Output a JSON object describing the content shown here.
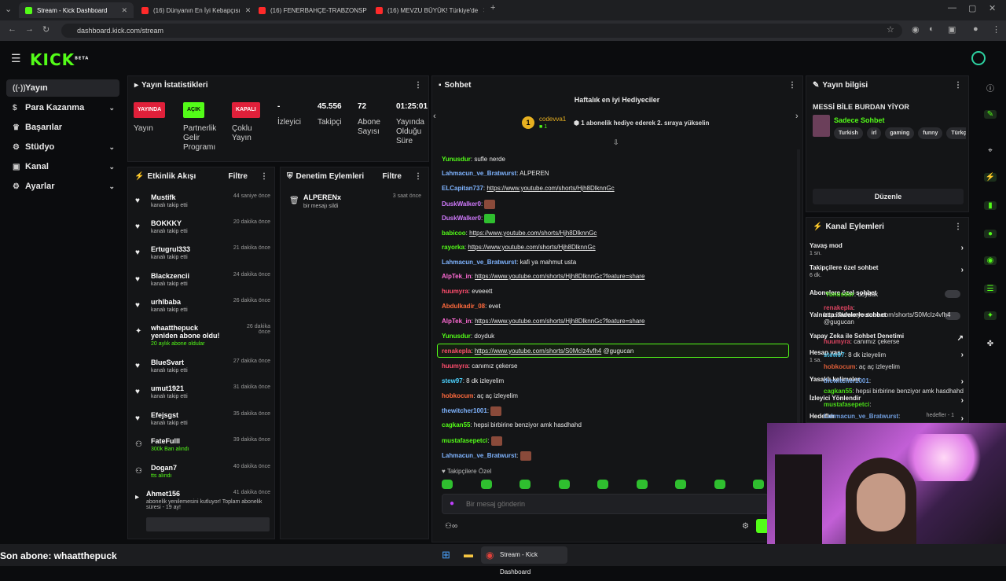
{
  "browser": {
    "tabs": [
      {
        "label": "Stream - Kick Dashboard",
        "active": true
      },
      {
        "label": "(16) Dünyanın En İyi Kebapçısı",
        "active": false
      },
      {
        "label": "(16) FENERBAHÇE-TRABZONSP",
        "active": false
      },
      {
        "label": "(16) MEVZU BÜYÜK! Türkiye'de",
        "active": false
      }
    ],
    "url": "dashboard.kick.com/stream"
  },
  "brand": {
    "logo": "KICK",
    "logo_sup": "BETA"
  },
  "sidebar": {
    "items": [
      {
        "label": "Yayın",
        "icon": "broadcast-icon",
        "has_chevron": false
      },
      {
        "label": "Para Kazanma",
        "icon": "money-icon",
        "has_chevron": true
      },
      {
        "label": "Başarılar",
        "icon": "trophy-icon",
        "has_chevron": false
      },
      {
        "label": "Stüdyo",
        "icon": "gear-icon",
        "has_chevron": true
      },
      {
        "label": "Kanal",
        "icon": "channel-icon",
        "has_chevron": true
      },
      {
        "label": "Ayarlar",
        "icon": "settings-icon",
        "has_chevron": true
      }
    ]
  },
  "stats": {
    "title": "Yayın İstatistikleri",
    "items": [
      {
        "badge": "YAYINDA",
        "label": "Yayın",
        "color": "#e0203a"
      },
      {
        "badge": "AÇIK",
        "label": "Partnerlik Gelir Programı",
        "color": "#53fc18"
      },
      {
        "badge": "KAPALI",
        "label": "Çoklu Yayın",
        "color": "#e0203a"
      },
      {
        "value": "-",
        "label": "İzleyici"
      },
      {
        "value": "45.556",
        "label": "Takipçi"
      },
      {
        "value": "72",
        "label": "Abone Sayısı"
      },
      {
        "value": "01:25:01",
        "label": "Yayında Olduğu Süre"
      }
    ]
  },
  "activity": {
    "title": "Etkinlik Akışı",
    "filter": "Filtre",
    "items": [
      {
        "name": "Mustifk",
        "sub": "kanalı takip etti",
        "time": "44 saniye önce"
      },
      {
        "name": "BOKKKY",
        "sub": "kanalı takip etti",
        "time": "20 dakika önce"
      },
      {
        "name": "Ertugrul333",
        "sub": "kanalı takip etti",
        "time": "21 dakika önce"
      },
      {
        "name": "Blackzencii",
        "sub": "kanalı takip etti",
        "time": "24 dakika önce"
      },
      {
        "name": "urhlbaba",
        "sub": "kanalı takip etti",
        "time": "26 dakika önce"
      },
      {
        "name": "whaatthepuck yeniden abone oldu!",
        "sub": "20 aylık abone oldular",
        "time": "26 dakika önce"
      },
      {
        "name": "BlueSvart",
        "sub": "kanalı takip etti",
        "time": "27 dakika önce"
      },
      {
        "name": "umut1921",
        "sub": "kanalı takip etti",
        "time": "31 dakika önce"
      },
      {
        "name": "Efejsgst",
        "sub": "kanalı takip etti",
        "time": "35 dakika önce"
      },
      {
        "name": "FateFulll",
        "sub": "300k Ban alındı",
        "time": "39 dakika önce"
      },
      {
        "name": "Dogan7",
        "sub": "tts alındı",
        "time": "40 dakika önce"
      },
      {
        "name": "Ahmet156",
        "sub": "abonelik yenilemesini kutluyor! Toplam abonelik süresi - 19 ay!",
        "time": "41 dakika önce"
      }
    ]
  },
  "moderation": {
    "title": "Denetim Eylemleri",
    "filter": "Filtre",
    "items": [
      {
        "name": "ALPERENx",
        "sub": "bir mesajı sildi",
        "time": "3 saat önce"
      }
    ]
  },
  "chat": {
    "title": "Sohbet",
    "gifters_title": "Haftalık en iyi Hediyeciler",
    "top_gifter": "codevva1",
    "top_gifter_count": "1",
    "gift_hint": "1 abonelik hediye ederek 2. sıraya yükselin",
    "messages": [
      {
        "user": "Yunusdur",
        "color": "#53fc18",
        "text": "sufle nerde"
      },
      {
        "user": "Lahmacun_ve_Bratwurst",
        "color": "#7fb4ff",
        "text": "ALPEREN"
      },
      {
        "user": "ELCapitan737",
        "color": "#7fb4ff",
        "link": "https://www.youtube.com/shorts/Hjh8DlknnGc"
      },
      {
        "user": "DuskWalker0",
        "color": "#d27bff",
        "text": ""
      },
      {
        "user": "DuskWalker0",
        "color": "#d27bff",
        "text": ""
      },
      {
        "user": "babicoo",
        "color": "#53fc18",
        "link": "https://www.youtube.com/shorts/Hjh8DlknnGc"
      },
      {
        "user": "rayorka",
        "color": "#53fc18",
        "link": "https://www.youtube.com/shorts/Hjh8DlknnGc"
      },
      {
        "user": "Lahmacun_ve_Bratwurst",
        "color": "#7fb4ff",
        "text": "kafi ya mahmut usta"
      },
      {
        "user": "AlpTek_in",
        "color": "#ff6bd5",
        "link": "https://www.youtube.com/shorts/Hjh8DlknnGc?feature=share"
      },
      {
        "user": "huumyra",
        "color": "#ff4d6d",
        "text": "eveeett"
      },
      {
        "user": "Abdulkadir_08",
        "color": "#ff6a3d",
        "text": "evet"
      },
      {
        "user": "AlpTek_in",
        "color": "#ff6bd5",
        "link": "https://www.youtube.com/shorts/Hjh8DlknnGc?feature=share"
      },
      {
        "user": "Yunusdur",
        "color": "#53fc18",
        "text": "doyduk"
      },
      {
        "user": "renakepla",
        "color": "#ff4d6d",
        "link": "https://www.youtube.com/shorts/S0McIz4vfh4",
        "text": "@gugucan"
      },
      {
        "user": "huumyra",
        "color": "#ff4d6d",
        "text": "canımız çekerse"
      },
      {
        "user": "stew97",
        "color": "#4dd2ff",
        "text": "8 dk izleyelim"
      },
      {
        "user": "hobkocum",
        "color": "#ff6a3d",
        "text": "aç aç izleyelim"
      },
      {
        "user": "thewitcher1001",
        "color": "#7fb4ff",
        "text": ""
      },
      {
        "user": "cagkan55",
        "color": "#53fc18",
        "text": "hepsi birbirine benziyor amk hasdhahd"
      },
      {
        "user": "mustafasepetci",
        "color": "#53fc18",
        "text": ""
      },
      {
        "user": "Lahmacun_ve_Bratwurst",
        "color": "#7fb4ff",
        "text": ""
      }
    ],
    "followers_only": "Takipçilere Özel",
    "input_placeholder": "Bir mesaj gönderin"
  },
  "stream_info": {
    "title": "Yayın bilgisi",
    "stream_title": "MESSİ BİLE BURDAN YİYOR",
    "category": "Sadece Sohbet",
    "tags": [
      "Turkish",
      "irl",
      "gaming",
      "funny",
      "Türkç"
    ],
    "edit_label": "Düzenle"
  },
  "channel_actions": {
    "title": "Kanal Eylemleri",
    "items": [
      {
        "label": "Yavaş mod",
        "sub": "1 sn."
      },
      {
        "label": "Takipçilere özel sohbet",
        "sub": "6 dk."
      },
      {
        "label": "Abonelere özel sohbet",
        "sub": ""
      },
      {
        "label": "Yalnızca ifadelerle sohbet",
        "sub": ""
      },
      {
        "label": "Yapay Zeka ile Sohbet Denetimi",
        "sub": ""
      },
      {
        "label": "Hesap yaşı",
        "sub": "1 sa."
      },
      {
        "label": "Yasaklı kelimeler",
        "sub": ""
      },
      {
        "label": "İzleyici Yönlendir",
        "sub": ""
      },
      {
        "label": "Hedefler",
        "sub": "hedefler - 1"
      }
    ],
    "overlay_msgs": [
      {
        "user": "Yunusdur",
        "text": "doyduk"
      },
      {
        "user": "renakepla",
        "text": "https://www.youtube.com/shorts/S0McIz4vfh4 @gugucan"
      },
      {
        "user": "huumyra",
        "text": "canımız çekerse"
      },
      {
        "user": "stew97",
        "text": "8 dk izleyelim"
      },
      {
        "user": "hobkocum",
        "text": "aç aç izleyelim"
      },
      {
        "user": "thewitcher1001",
        "text": ""
      },
      {
        "user": "cagkan55",
        "text": "hepsi birbirine benziyor amk hasdhahd"
      },
      {
        "user": "mustafasepetci",
        "text": ""
      },
      {
        "user": "Lahmacun_ve_Bratwurst",
        "text": ""
      }
    ]
  },
  "overlay": {
    "last_sub": "Son abone: whaatthepuck"
  },
  "taskbar": {
    "app_label": "Stream - Kick Dashboard"
  },
  "colors": {
    "accent": "#53fc18",
    "live": "#e0203a"
  }
}
